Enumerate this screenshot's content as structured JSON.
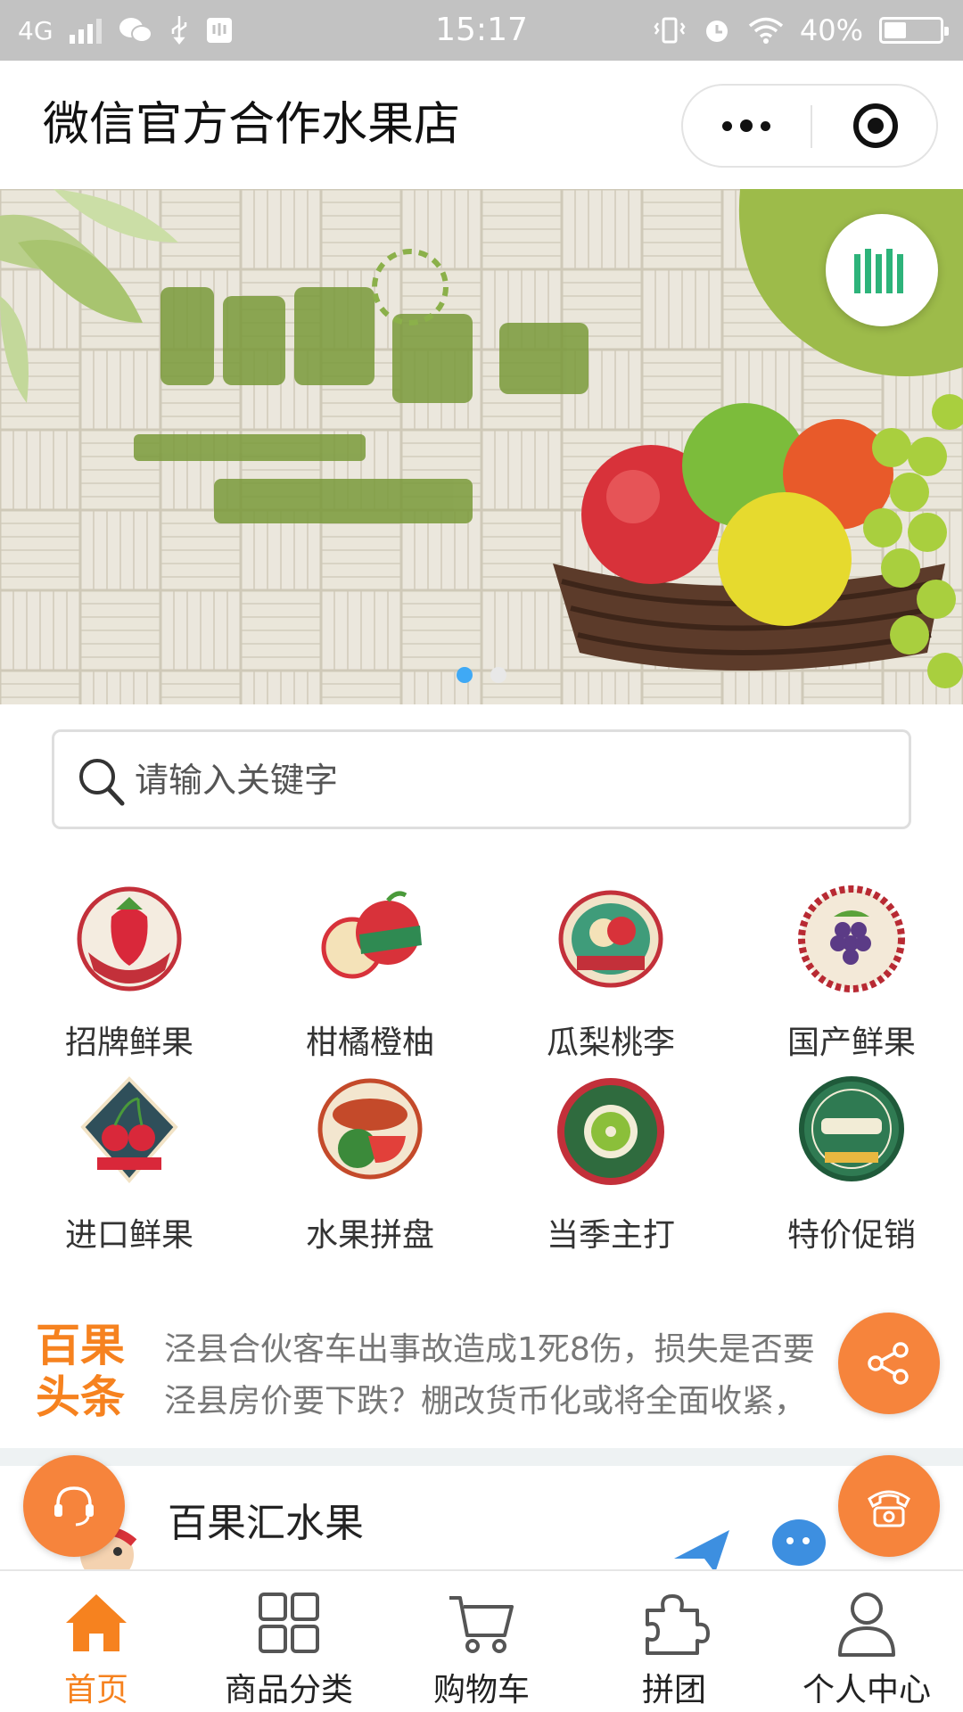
{
  "status_bar": {
    "network": "4G",
    "time": "15:17",
    "battery_percent": "40%",
    "battery_level": 0.4,
    "icons": [
      "signal-icon",
      "wechat-icon",
      "usb-icon",
      "debug-icon",
      "vibrate-icon",
      "alarm-icon",
      "wifi-icon",
      "battery-icon"
    ]
  },
  "title_bar": {
    "title": "微信官方合作水果店",
    "icons": [
      "more-icon",
      "close-target-icon"
    ]
  },
  "banner": {
    "slide_count": 2,
    "active_slide": 0
  },
  "search": {
    "placeholder": "请输入关键字"
  },
  "categories": [
    {
      "label": "招牌鲜果",
      "icon": "strawberry-badge-icon"
    },
    {
      "label": "柑橘橙柚",
      "icon": "apple-badge-icon"
    },
    {
      "label": "瓜梨桃李",
      "icon": "apple-label-icon"
    },
    {
      "label": "国产鲜果",
      "icon": "grapes-badge-icon"
    },
    {
      "label": "进口鲜果",
      "icon": "cherry-badge-icon"
    },
    {
      "label": "水果拼盘",
      "icon": "watermelon-badge-icon"
    },
    {
      "label": "当季主打",
      "icon": "kiwi-badge-icon"
    },
    {
      "label": "特价促销",
      "icon": "nature-badge-icon"
    }
  ],
  "news": {
    "brand_line1": "百果",
    "brand_line2": "头条",
    "items": [
      "泾县合伙客车出事故造成1死8伤，损失是否要",
      "泾县房价要下跌？棚改货币化或将全面收紧，"
    ]
  },
  "shop": {
    "name": "百果汇水果"
  },
  "floating_buttons": [
    "share-icon",
    "customer-service-icon",
    "phone-icon"
  ],
  "colors": {
    "accent": "#f6821f",
    "fab": "#f6843c",
    "status_bar": "#c2c2c2",
    "dot_active": "#3fa9f5"
  },
  "tabbar": [
    {
      "label": "首页",
      "icon": "home-icon",
      "active": true
    },
    {
      "label": "商品分类",
      "icon": "grid-icon",
      "active": false
    },
    {
      "label": "购物车",
      "icon": "cart-icon",
      "active": false
    },
    {
      "label": "拼团",
      "icon": "puzzle-icon",
      "active": false
    },
    {
      "label": "个人中心",
      "icon": "user-icon",
      "active": false
    }
  ]
}
